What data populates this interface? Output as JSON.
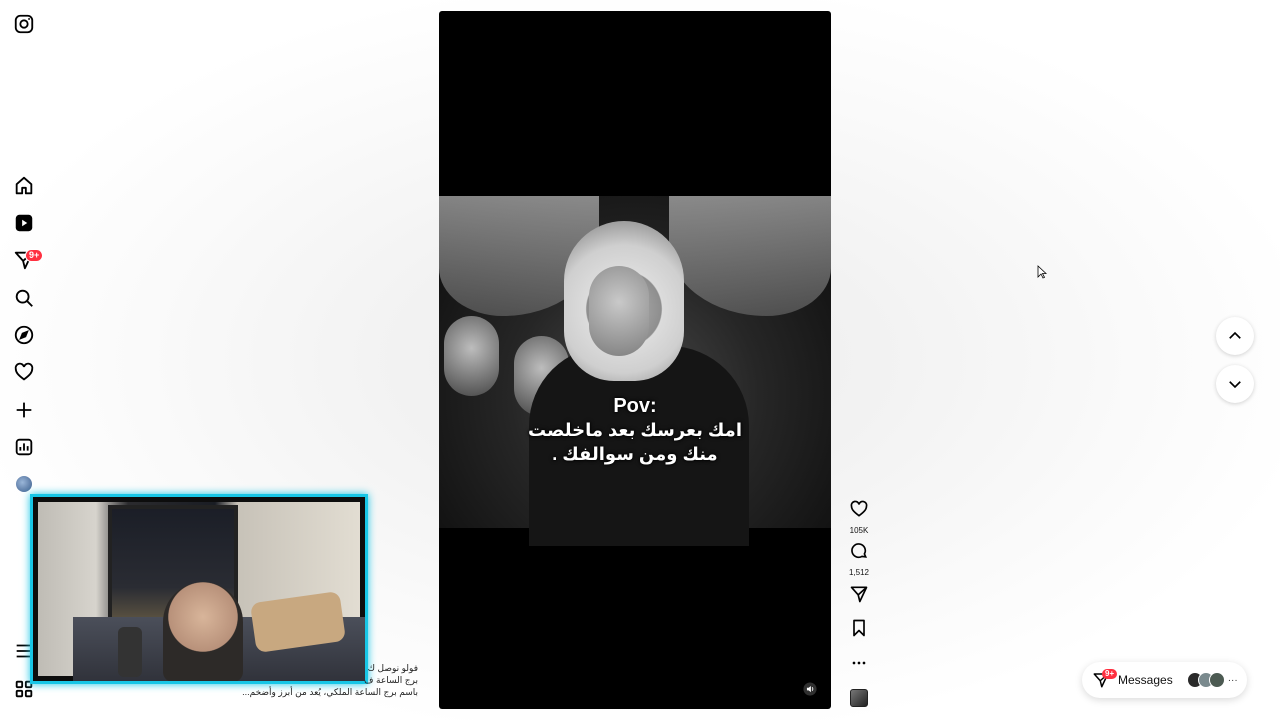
{
  "sidebar": {
    "items": [
      {
        "name": "instagram-logo-icon"
      },
      {
        "name": "home-icon"
      },
      {
        "name": "reels-icon"
      },
      {
        "name": "messenger-icon",
        "badge": "9+"
      },
      {
        "name": "search-icon"
      },
      {
        "name": "explore-icon"
      },
      {
        "name": "notifications-heart-icon"
      },
      {
        "name": "create-plus-icon"
      },
      {
        "name": "dashboard-icon"
      },
      {
        "name": "profile-avatar"
      },
      {
        "name": "menu-icon"
      },
      {
        "name": "more-apps-icon"
      }
    ],
    "messenger_badge": "9+"
  },
  "reel": {
    "overlay_title": "Pov:",
    "overlay_line1": "امك بعرسك بعد ماخلصت",
    "overlay_line2": "منك ومن سوالفك .",
    "caption_lines": [
      "فولو نوصل ك",
      "برج الساعة ف",
      "باسم برج الساعة الملكي، يُعد من أبرز وأضخم..."
    ]
  },
  "actions": {
    "likes": "105K",
    "comments": "1,512"
  },
  "messages": {
    "label": "Messages",
    "badge": "9+"
  },
  "colors": {
    "badge_red": "#ff3040",
    "webcam_border": "#18c6e6"
  }
}
